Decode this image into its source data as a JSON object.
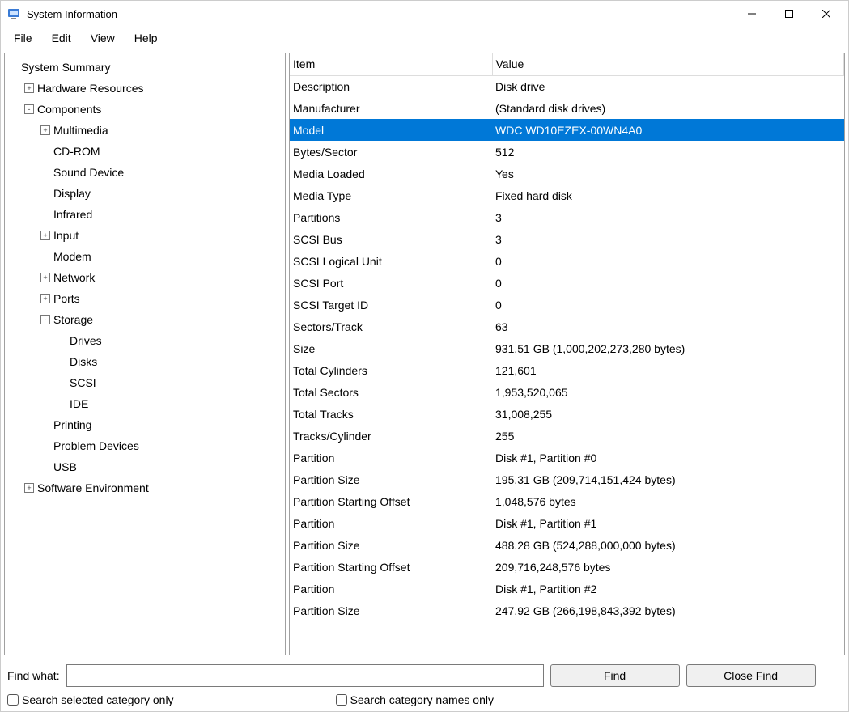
{
  "title": "System Information",
  "menu": [
    "File",
    "Edit",
    "View",
    "Help"
  ],
  "tree": [
    {
      "label": "System Summary",
      "indent": 0,
      "expander": ""
    },
    {
      "label": "Hardware Resources",
      "indent": 1,
      "expander": "+"
    },
    {
      "label": "Components",
      "indent": 1,
      "expander": "-"
    },
    {
      "label": "Multimedia",
      "indent": 2,
      "expander": "+"
    },
    {
      "label": "CD-ROM",
      "indent": 2,
      "expander": ""
    },
    {
      "label": "Sound Device",
      "indent": 2,
      "expander": ""
    },
    {
      "label": "Display",
      "indent": 2,
      "expander": ""
    },
    {
      "label": "Infrared",
      "indent": 2,
      "expander": ""
    },
    {
      "label": "Input",
      "indent": 2,
      "expander": "+"
    },
    {
      "label": "Modem",
      "indent": 2,
      "expander": ""
    },
    {
      "label": "Network",
      "indent": 2,
      "expander": "+"
    },
    {
      "label": "Ports",
      "indent": 2,
      "expander": "+"
    },
    {
      "label": "Storage",
      "indent": 2,
      "expander": "-"
    },
    {
      "label": "Drives",
      "indent": 3,
      "expander": ""
    },
    {
      "label": "Disks",
      "indent": 3,
      "expander": "",
      "selected": true
    },
    {
      "label": "SCSI",
      "indent": 3,
      "expander": ""
    },
    {
      "label": "IDE",
      "indent": 3,
      "expander": ""
    },
    {
      "label": "Printing",
      "indent": 2,
      "expander": ""
    },
    {
      "label": "Problem Devices",
      "indent": 2,
      "expander": ""
    },
    {
      "label": "USB",
      "indent": 2,
      "expander": ""
    },
    {
      "label": "Software Environment",
      "indent": 1,
      "expander": "+"
    }
  ],
  "columns": [
    "Item",
    "Value"
  ],
  "rows": [
    {
      "item": "Description",
      "value": "Disk drive"
    },
    {
      "item": "Manufacturer",
      "value": "(Standard disk drives)"
    },
    {
      "item": "Model",
      "value": "WDC WD10EZEX-00WN4A0",
      "selected": true
    },
    {
      "item": "Bytes/Sector",
      "value": "512"
    },
    {
      "item": "Media Loaded",
      "value": "Yes"
    },
    {
      "item": "Media Type",
      "value": "Fixed hard disk"
    },
    {
      "item": "Partitions",
      "value": "3"
    },
    {
      "item": "SCSI Bus",
      "value": "3"
    },
    {
      "item": "SCSI Logical Unit",
      "value": "0"
    },
    {
      "item": "SCSI Port",
      "value": "0"
    },
    {
      "item": "SCSI Target ID",
      "value": "0"
    },
    {
      "item": "Sectors/Track",
      "value": "63"
    },
    {
      "item": "Size",
      "value": "931.51 GB (1,000,202,273,280 bytes)"
    },
    {
      "item": "Total Cylinders",
      "value": "121,601"
    },
    {
      "item": "Total Sectors",
      "value": "1,953,520,065"
    },
    {
      "item": "Total Tracks",
      "value": "31,008,255"
    },
    {
      "item": "Tracks/Cylinder",
      "value": "255"
    },
    {
      "item": "Partition",
      "value": "Disk #1, Partition #0"
    },
    {
      "item": "Partition Size",
      "value": "195.31 GB (209,714,151,424 bytes)"
    },
    {
      "item": "Partition Starting Offset",
      "value": "1,048,576 bytes"
    },
    {
      "item": "Partition",
      "value": "Disk #1, Partition #1"
    },
    {
      "item": "Partition Size",
      "value": "488.28 GB (524,288,000,000 bytes)"
    },
    {
      "item": "Partition Starting Offset",
      "value": "209,716,248,576 bytes"
    },
    {
      "item": "Partition",
      "value": "Disk #1, Partition #2"
    },
    {
      "item": "Partition Size",
      "value": "247.92 GB (266,198,843,392 bytes)"
    }
  ],
  "find": {
    "label": "Find what:",
    "value": "",
    "find_btn": "Find",
    "close_btn": "Close Find",
    "opt1": "Search selected category only",
    "opt2": "Search category names only"
  }
}
